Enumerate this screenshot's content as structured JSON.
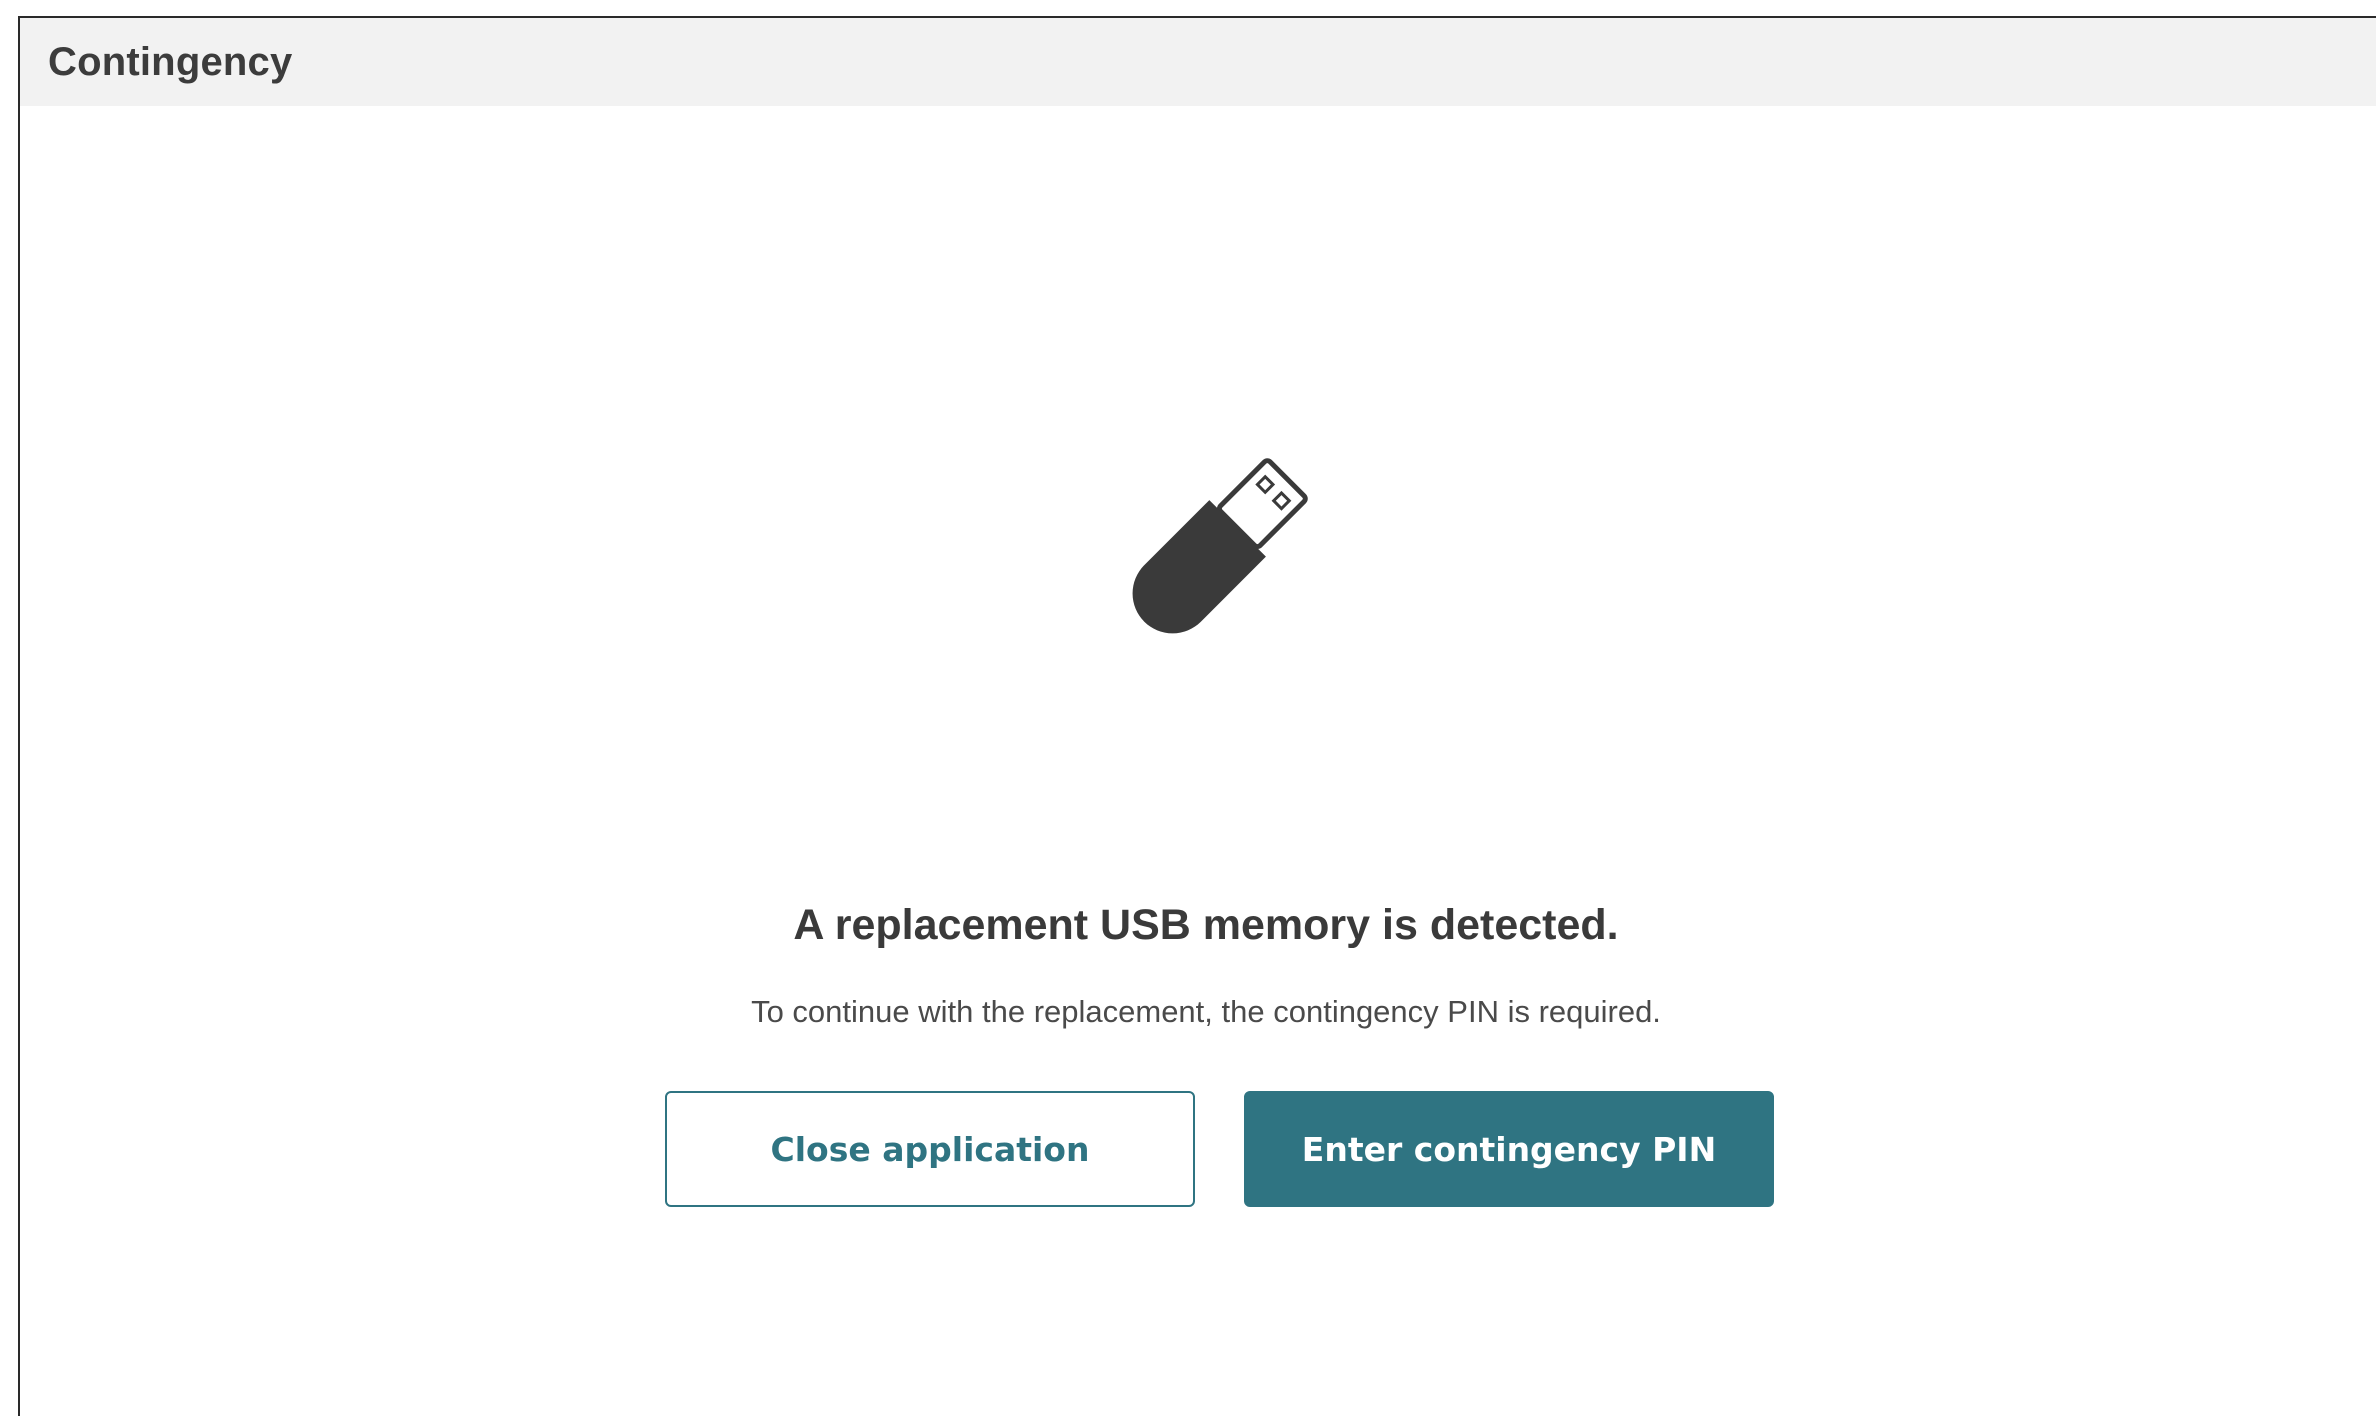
{
  "window": {
    "title": "Contingency"
  },
  "dialog": {
    "icon": "usb-drive-icon",
    "heading": "A replacement USB memory is detected.",
    "message": "To continue with the replacement, the contingency PIN is required."
  },
  "actions": {
    "close_label": "Close application",
    "enter_pin_label": "Enter contingency PIN"
  },
  "colors": {
    "accent": "#2f7482",
    "titlebar_bg": "#f2f2f2",
    "icon": "#3a3a3a"
  }
}
